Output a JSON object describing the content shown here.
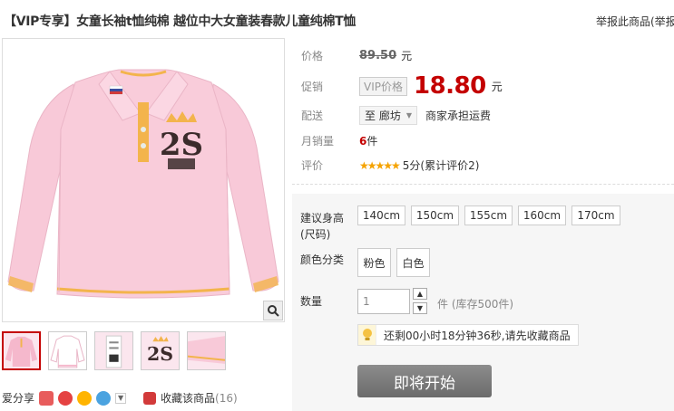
{
  "header": {
    "title": "【VIP专享】女童长袖t恤纯棉 越位中大女童装春款儿童纯棉T恤",
    "report": "举报此商品(举报"
  },
  "gallery": {
    "thumbnails": [
      {
        "name": "front-pink-shirt"
      },
      {
        "name": "white-shirt"
      },
      {
        "name": "label-closeup"
      },
      {
        "name": "logo-closeup"
      },
      {
        "name": "sleeve-detail"
      }
    ]
  },
  "share": {
    "label": "爱分享",
    "favorite_label": "收藏该商品",
    "favorite_count": "(16)"
  },
  "props": {
    "price_label": "价格",
    "original_price": "89.50",
    "currency": "元",
    "promo_label": "促销",
    "vip_tag": "VIP价格",
    "promo_price": "18.80",
    "delivery_label": "配送",
    "delivery_dest": "至 廊坊",
    "delivery_note": "商家承担运费",
    "monthly_label": "月销量",
    "monthly_count": "6",
    "monthly_unit": "件",
    "rating_label": "评价",
    "rating_stars": "★★★★★",
    "rating_text": "5分(累计评价2)"
  },
  "sku": {
    "size_label_line1": "建议身高",
    "size_label_line2": "(尺码)",
    "sizes": [
      "140cm",
      "150cm",
      "155cm",
      "160cm",
      "170cm"
    ],
    "color_label": "颜色分类",
    "colors": [
      "粉色",
      "白色"
    ],
    "qty_label": "数量",
    "qty_value": "1",
    "stock": "件 (库存500件)",
    "countdown": "还剩00小时18分钟36秒,请先收藏商品",
    "buy_label": "即将开始"
  },
  "colors": {
    "accent": "#c40000",
    "shirt_pink": "#f8c9d8",
    "trim_yellow": "#f3b44c",
    "star": "#f5a300"
  }
}
